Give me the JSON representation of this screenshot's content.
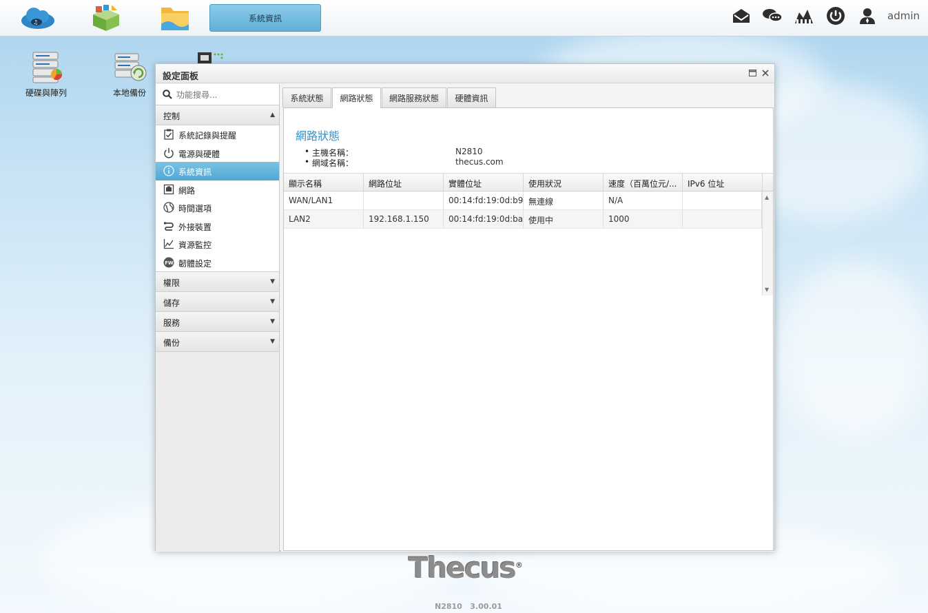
{
  "taskbar": {
    "active_tab": "系統資訊",
    "user": "admin",
    "icons": [
      "cloud-icon",
      "app-center-icon",
      "file-manager-icon"
    ],
    "right_icons": [
      "mail-icon",
      "chat-icon",
      "network-icon",
      "power-icon",
      "user-icon"
    ]
  },
  "desktop": {
    "icons": [
      {
        "label": "硬碟與陣列"
      },
      {
        "label": "本地備份"
      }
    ]
  },
  "window": {
    "title": "設定面板"
  },
  "sidebar": {
    "search_placeholder": "功能搜尋...",
    "control": {
      "label": "控制",
      "items": [
        {
          "label": "系統記錄與提醒",
          "icon": "clipboard-check-icon"
        },
        {
          "label": "電源與硬體",
          "icon": "power-icon"
        },
        {
          "label": "系統資訊",
          "icon": "info-icon",
          "active": true
        },
        {
          "label": "網路",
          "icon": "ethernet-icon"
        },
        {
          "label": "時間選項",
          "icon": "globe-icon"
        },
        {
          "label": "外接裝置",
          "icon": "usb-icon"
        },
        {
          "label": "資源監控",
          "icon": "chart-icon"
        },
        {
          "label": "韌體設定",
          "icon": "firmware-icon"
        }
      ]
    },
    "sections": [
      {
        "label": "權限"
      },
      {
        "label": "儲存"
      },
      {
        "label": "服務"
      },
      {
        "label": "備份"
      }
    ]
  },
  "tabs": [
    {
      "label": "系統狀態"
    },
    {
      "label": "網路狀態",
      "active": true
    },
    {
      "label": "網路服務狀態"
    },
    {
      "label": "硬體資訊"
    }
  ],
  "network_status": {
    "title": "網路狀態",
    "host_label": "主機名稱：",
    "host_value": "N2810",
    "domain_label": "網域名稱：",
    "domain_value": "thecus.com"
  },
  "table": {
    "columns": [
      "顯示名稱",
      "網路位址",
      "實體位址",
      "使用狀況",
      "速度（百萬位元/...",
      "IPv6 位址"
    ],
    "rows": [
      [
        "WAN/LAN1",
        "",
        "00:14:fd:19:0d:b9",
        "無連線",
        "N/A",
        ""
      ],
      [
        "LAN2",
        "192.168.1.150",
        "00:14:fd:19:0d:ba",
        "使用中",
        "1000",
        ""
      ]
    ]
  },
  "footer": {
    "logo": "Thecus",
    "logo_mark": "®",
    "version": "N2810   3.00.01"
  }
}
